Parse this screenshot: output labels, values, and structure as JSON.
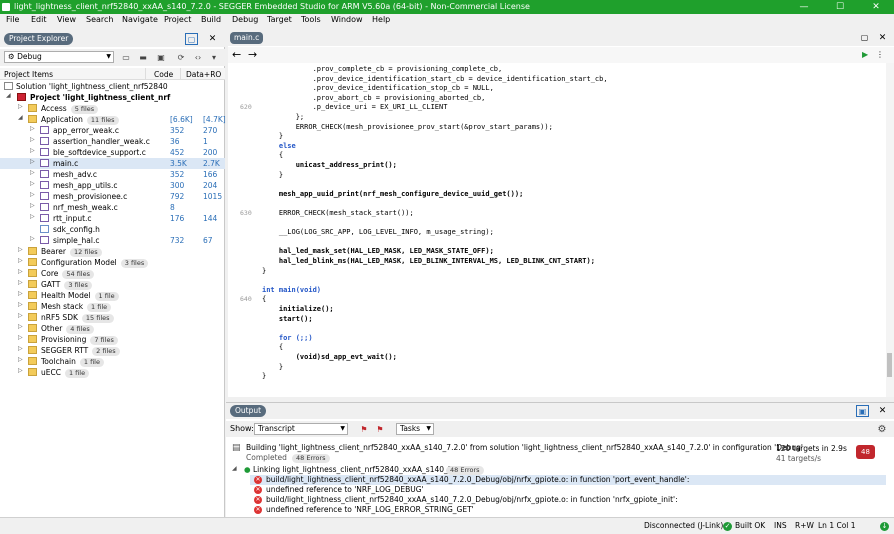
{
  "window": {
    "title": "light_lightness_client_nrf52840_xxAA_s140_7.2.0 - SEGGER Embedded Studio for ARM V5.60a (64-bit) - Non-Commercial License",
    "minimize": "—",
    "maximize": "☐",
    "close": "✕"
  },
  "menu": [
    "File",
    "Edit",
    "View",
    "Search",
    "Navigate",
    "Project",
    "Build",
    "Debug",
    "Target",
    "Tools",
    "Window",
    "Help"
  ],
  "explorer": {
    "tab": "Project Explorer",
    "config": "Debug",
    "columns": {
      "items": "Project Items",
      "code": "Code",
      "dataro": "Data+RO"
    },
    "solution": "Solution 'light_lightness_client_nrf52840",
    "project": "Project 'light_lightness_client_nrf",
    "rows": [
      {
        "label": "Access",
        "badge": "5 files",
        "type": "folder",
        "level": 2,
        "exp": "▷",
        "code": "",
        "dro": ""
      },
      {
        "label": "Application",
        "badge": "11 files",
        "type": "folder",
        "level": 2,
        "exp": "◢",
        "code": "[6.6K]",
        "dro": "[4.7K]"
      },
      {
        "label": "app_error_weak.c",
        "badge": "",
        "type": "c",
        "level": 3,
        "exp": "▷",
        "code": "352",
        "dro": "270"
      },
      {
        "label": "assertion_handler_weak.c",
        "badge": "",
        "type": "c",
        "level": 3,
        "exp": "▷",
        "code": "36",
        "dro": "1"
      },
      {
        "label": "ble_softdevice_support.c",
        "badge": "",
        "type": "c",
        "level": 3,
        "exp": "▷",
        "code": "452",
        "dro": "200"
      },
      {
        "label": "main.c",
        "badge": "",
        "type": "c",
        "level": 3,
        "exp": "▷",
        "code": "3.5K",
        "dro": "2.7K",
        "sel": true
      },
      {
        "label": "mesh_adv.c",
        "badge": "",
        "type": "c",
        "level": 3,
        "exp": "▷",
        "code": "352",
        "dro": "166"
      },
      {
        "label": "mesh_app_utils.c",
        "badge": "",
        "type": "c",
        "level": 3,
        "exp": "▷",
        "code": "300",
        "dro": "204"
      },
      {
        "label": "mesh_provisionee.c",
        "badge": "",
        "type": "c",
        "level": 3,
        "exp": "▷",
        "code": "792",
        "dro": "1015"
      },
      {
        "label": "nrf_mesh_weak.c",
        "badge": "",
        "type": "c",
        "level": 3,
        "exp": "▷",
        "code": "8",
        "dro": ""
      },
      {
        "label": "rtt_input.c",
        "badge": "",
        "type": "c",
        "level": 3,
        "exp": "▷",
        "code": "176",
        "dro": "144"
      },
      {
        "label": "sdk_config.h",
        "badge": "",
        "type": "h",
        "level": 3,
        "exp": "",
        "code": "",
        "dro": ""
      },
      {
        "label": "simple_hal.c",
        "badge": "",
        "type": "c",
        "level": 3,
        "exp": "▷",
        "code": "732",
        "dro": "67"
      },
      {
        "label": "Bearer",
        "badge": "12 files",
        "type": "folder",
        "level": 2,
        "exp": "▷",
        "code": "",
        "dro": ""
      },
      {
        "label": "Configuration Model",
        "badge": "3 files",
        "type": "folder",
        "level": 2,
        "exp": "▷",
        "code": "",
        "dro": ""
      },
      {
        "label": "Core",
        "badge": "54 files",
        "type": "folder",
        "level": 2,
        "exp": "▷",
        "code": "",
        "dro": ""
      },
      {
        "label": "GATT",
        "badge": "3 files",
        "type": "folder",
        "level": 2,
        "exp": "▷",
        "code": "",
        "dro": ""
      },
      {
        "label": "Health Model",
        "badge": "1 file",
        "type": "folder",
        "level": 2,
        "exp": "▷",
        "code": "",
        "dro": ""
      },
      {
        "label": "Mesh stack",
        "badge": "1 file",
        "type": "folder",
        "level": 2,
        "exp": "▷",
        "code": "",
        "dro": ""
      },
      {
        "label": "nRF5 SDK",
        "badge": "15 files",
        "type": "folder",
        "level": 2,
        "exp": "▷",
        "code": "",
        "dro": ""
      },
      {
        "label": "Other",
        "badge": "4 files",
        "type": "folder",
        "level": 2,
        "exp": "▷",
        "code": "",
        "dro": ""
      },
      {
        "label": "Provisioning",
        "badge": "7 files",
        "type": "folder",
        "level": 2,
        "exp": "▷",
        "code": "",
        "dro": ""
      },
      {
        "label": "SEGGER RTT",
        "badge": "2 files",
        "type": "folder",
        "level": 2,
        "exp": "▷",
        "code": "",
        "dro": ""
      },
      {
        "label": "Toolchain",
        "badge": "1 file",
        "type": "folder",
        "level": 2,
        "exp": "▷",
        "code": "",
        "dro": ""
      },
      {
        "label": "uECC",
        "badge": "1 file",
        "type": "folder",
        "level": 2,
        "exp": "▷",
        "code": "",
        "dro": ""
      }
    ]
  },
  "editor": {
    "tab": "main.c",
    "lines": [
      {
        "n": "",
        "t": "            .prov_complete_cb = provisioning_complete_cb,"
      },
      {
        "n": "",
        "t": "            .prov_device_identification_start_cb = device_identification_start_cb,"
      },
      {
        "n": "",
        "t": "            .prov_device_identification_stop_cb = NULL,"
      },
      {
        "n": "",
        "t": "            .prov_abort_cb = provisioning_aborted_cb,"
      },
      {
        "n": "620",
        "t": "            .p_device_uri = EX_URI_LL_CLIENT"
      },
      {
        "n": "",
        "t": "        };"
      },
      {
        "n": "",
        "t": "        ERROR_CHECK(mesh_provisionee_prov_start(&prov_start_params));"
      },
      {
        "n": "",
        "t": "    }"
      },
      {
        "n": "",
        "t": "    else",
        "kw": true
      },
      {
        "n": "",
        "t": "    {"
      },
      {
        "n": "",
        "t": "        unicast_address_print();",
        "bold": true
      },
      {
        "n": "",
        "t": "    }"
      },
      {
        "n": "",
        "t": ""
      },
      {
        "n": "",
        "t": "    mesh_app_uuid_print(nrf_mesh_configure_device_uuid_get());",
        "bold": true
      },
      {
        "n": "",
        "t": ""
      },
      {
        "n": "630",
        "t": "    ERROR_CHECK(mesh_stack_start());"
      },
      {
        "n": "",
        "t": ""
      },
      {
        "n": "",
        "t": "    __LOG(LOG_SRC_APP, LOG_LEVEL_INFO, m_usage_string);"
      },
      {
        "n": "",
        "t": ""
      },
      {
        "n": "",
        "t": "    hal_led_mask_set(HAL_LED_MASK, LED_MASK_STATE_OFF);",
        "bold": true
      },
      {
        "n": "",
        "t": "    hal_led_blink_ms(HAL_LED_MASK, LED_BLINK_INTERVAL_MS, LED_BLINK_CNT_START);",
        "bold": true
      },
      {
        "n": "",
        "t": "}"
      },
      {
        "n": "",
        "t": ""
      },
      {
        "n": "",
        "t": "int main(void)",
        "kw": true
      },
      {
        "n": "640",
        "t": "{"
      },
      {
        "n": "",
        "t": "    initialize();",
        "bold": true
      },
      {
        "n": "",
        "t": "    start();",
        "bold": true
      },
      {
        "n": "",
        "t": ""
      },
      {
        "n": "",
        "t": "    for (;;)",
        "kw": true
      },
      {
        "n": "",
        "t": "    {"
      },
      {
        "n": "",
        "t": "        (void)sd_app_evt_wait();",
        "bold": true
      },
      {
        "n": "",
        "t": "    }"
      },
      {
        "n": "",
        "t": "}"
      }
    ]
  },
  "output": {
    "tab": "Output",
    "show_label": "Show:",
    "show_value": "Transcript",
    "tasks_value": "Tasks",
    "build_line": "Building 'light_lightness_client_nrf52840_xxAA_s140_7.2.0' from solution 'light_lightness_client_nrf52840_xxAA_s140_7.2.0' in configuration 'Debug'",
    "completed": "Completed",
    "errors_badge": "48 Errors",
    "targets": "120 targets in 2.9s",
    "rate": "41 targets/s",
    "error_count": "48",
    "link_line": "Linking light_lightness_client_nrf52840_xxAA_s140_7.2.0.elf",
    "link_errors": "48 Errors",
    "messages": [
      "build/light_lightness_client_nrf52840_xxAA_s140_7.2.0_Debug/obj/nrfx_gpiote.o: in function 'port_event_handle':",
      "undefined reference to 'NRF_LOG_DEBUG'",
      "build/light_lightness_client_nrf52840_xxAA_s140_7.2.0_Debug/obj/nrfx_gpiote.o: in function 'nrfx_gpiote_init':",
      "undefined reference to 'NRF_LOG_ERROR_STRING_GET'"
    ]
  },
  "status": {
    "connection": "Disconnected (J-Link)",
    "build": "Built OK",
    "ins": "INS",
    "rw": "R+W",
    "pos": "Ln 1 Col 1"
  }
}
